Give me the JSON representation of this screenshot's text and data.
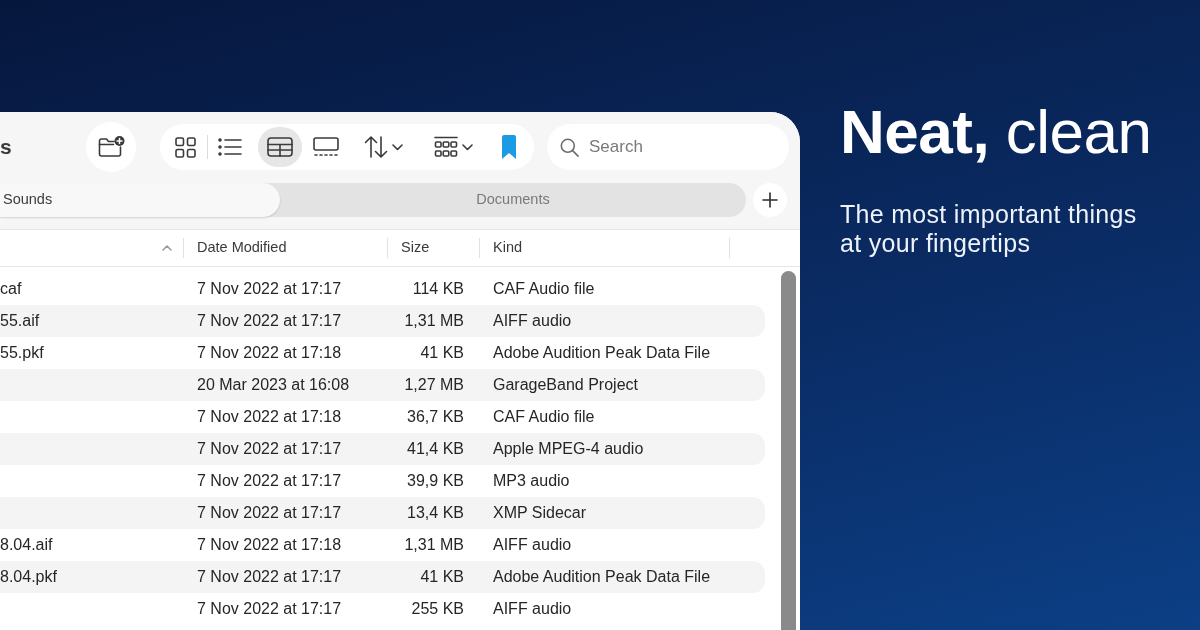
{
  "window": {
    "title": "s"
  },
  "toolbar": {
    "view_modes": [
      {
        "selected": false
      },
      {
        "selected": false
      },
      {
        "selected": true
      },
      {
        "selected": false
      }
    ],
    "search": {
      "placeholder": "Search"
    }
  },
  "tabs": [
    {
      "label": "Sounds",
      "selected": true
    },
    {
      "label": "Documents",
      "selected": false
    }
  ],
  "table": {
    "columns": [
      {
        "sorted": true
      },
      {
        "label": "Date Modified",
        "sorted": false
      },
      {
        "label": "Size",
        "sorted": false
      },
      {
        "label": "Kind",
        "sorted": false
      }
    ],
    "rows": [
      {
        "column_1": "caf",
        "date_modified": "7 Nov 2022 at 17:17",
        "size": "114 KB",
        "kind": "CAF Audio file"
      },
      {
        "column_1": "55.aif",
        "date_modified": "7 Nov 2022 at 17:17",
        "size": "1,31 MB",
        "kind": "AIFF audio"
      },
      {
        "column_1": "55.pkf",
        "date_modified": "7 Nov 2022 at 17:18",
        "size": "41 KB",
        "kind": "Adobe Audition Peak Data File"
      },
      {
        "date_modified": "20 Mar 2023 at 16:08",
        "size": "1,27 MB",
        "kind": "GarageBand Project"
      },
      {
        "date_modified": "7 Nov 2022 at 17:18",
        "size": "36,7 KB",
        "kind": "CAF Audio file"
      },
      {
        "date_modified": "7 Nov 2022 at 17:17",
        "size": "41,4 KB",
        "kind": "Apple MPEG-4 audio"
      },
      {
        "date_modified": "7 Nov 2022 at 17:17",
        "size": "39,9 KB",
        "kind": "MP3 audio"
      },
      {
        "date_modified": "7 Nov 2022 at 17:17",
        "size": "13,4 KB",
        "kind": "XMP Sidecar"
      },
      {
        "column_1": "8.04.aif",
        "date_modified": "7 Nov 2022 at 17:18",
        "size": "1,31 MB",
        "kind": "AIFF audio"
      },
      {
        "column_1": "8.04.pkf",
        "date_modified": "7 Nov 2022 at 17:17",
        "size": "41 KB",
        "kind": "Adobe Audition Peak Data File"
      },
      {
        "date_modified": "7 Nov 2022 at 17:17",
        "size": "255 KB",
        "kind": "AIFF audio"
      }
    ]
  },
  "promo": {
    "heading": "**Neat,** clean",
    "subheading": "The most important things at your fingertips"
  }
}
